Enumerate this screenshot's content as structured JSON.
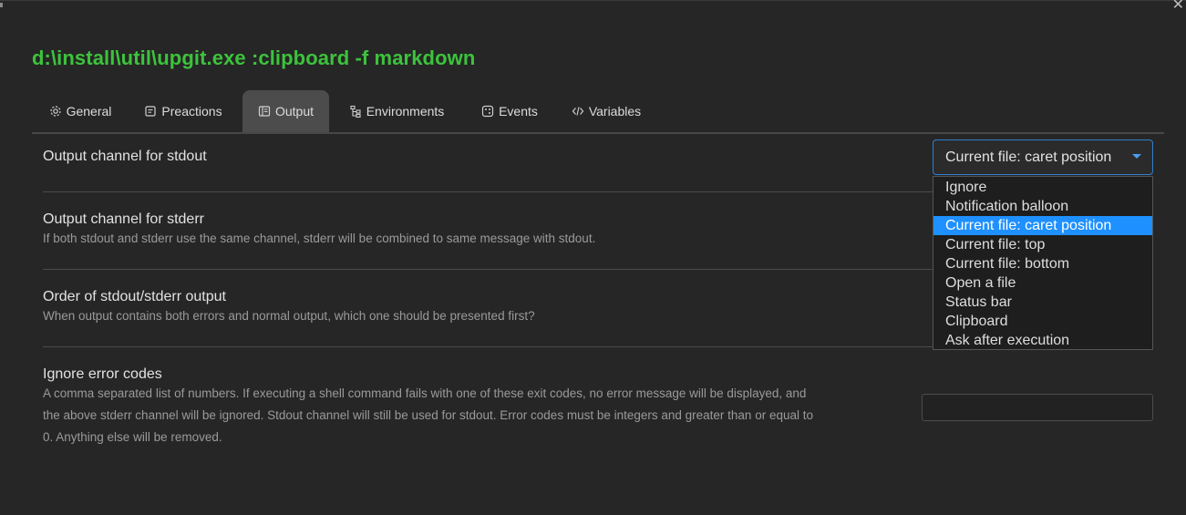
{
  "window": {
    "title": "d:\\install\\util\\upgit.exe :clipboard -f markdown",
    "close_glyph": "✕"
  },
  "tabs": [
    {
      "label": "General",
      "icon": "gear-icon"
    },
    {
      "label": "Preactions",
      "icon": "note-icon"
    },
    {
      "label": "Output",
      "icon": "document-icon",
      "active": true
    },
    {
      "label": "Environments",
      "icon": "tree-icon"
    },
    {
      "label": "Events",
      "icon": "dice-icon"
    },
    {
      "label": "Variables",
      "icon": "code-icon"
    }
  ],
  "settings": {
    "stdout": {
      "title": "Output channel for stdout",
      "selected": "Current file: caret position",
      "options": [
        "Ignore",
        "Notification balloon",
        "Current file: caret position",
        "Current file: top",
        "Current file: bottom",
        "Open a file",
        "Status bar",
        "Clipboard",
        "Ask after execution"
      ]
    },
    "stderr": {
      "title": "Output channel for stderr",
      "description": "If both stdout and stderr use the same channel, stderr will be combined to same message with stdout."
    },
    "order": {
      "title": "Order of stdout/stderr output",
      "description": "When output contains both errors and normal output, which one should be presented first?"
    },
    "ignore_codes": {
      "title": "Ignore error codes",
      "description_lines": [
        "A comma separated list of numbers. If executing a shell command fails with one of these exit codes, no error message will be displayed, and",
        "the above stderr channel will be ignored. Stdout channel will still be used for stdout. Error codes must be integers and greater than or equal to",
        "0. Anything else will be removed."
      ],
      "value": ""
    }
  },
  "colors": {
    "title": "#3cc33c",
    "accent": "#1e90ff",
    "background": "#262626"
  }
}
